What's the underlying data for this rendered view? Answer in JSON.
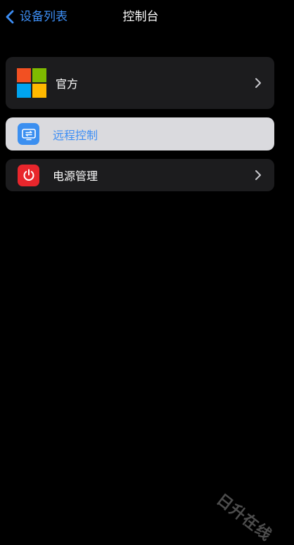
{
  "nav": {
    "back_label": "设备列表",
    "title": "控制台",
    "accent": "#3d8ef5"
  },
  "items": [
    {
      "label": "官方",
      "icon": "microsoft-logo",
      "chevron": true
    },
    {
      "label": "远程控制",
      "icon": "remote-control-icon",
      "selected": true
    },
    {
      "label": "电源管理",
      "icon": "power-icon",
      "chevron": true
    }
  ],
  "colors": {
    "background": "#000000",
    "card": "#1c1c1e",
    "selected_card": "#dadade",
    "ms_red": "#f25022",
    "ms_green": "#7fba00",
    "ms_blue": "#00a4ef",
    "ms_yellow": "#ffb900",
    "remote_icon_bg": "#3b8ff0",
    "power_icon_bg": "#e8262c"
  },
  "watermark": "日升在线"
}
